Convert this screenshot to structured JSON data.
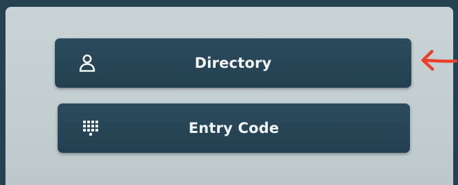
{
  "menu": {
    "directory": {
      "label": "Directory",
      "icon": "person-icon"
    },
    "entry_code": {
      "label": "Entry Code",
      "icon": "keypad-icon"
    }
  },
  "annotation": {
    "icon": "red-arrow-icon",
    "color": "#e8402b"
  },
  "colors": {
    "screen_background": "#c5d0d3",
    "button_background": "#26455a",
    "button_text": "#f2f6f7",
    "bezel": "#26414f"
  }
}
